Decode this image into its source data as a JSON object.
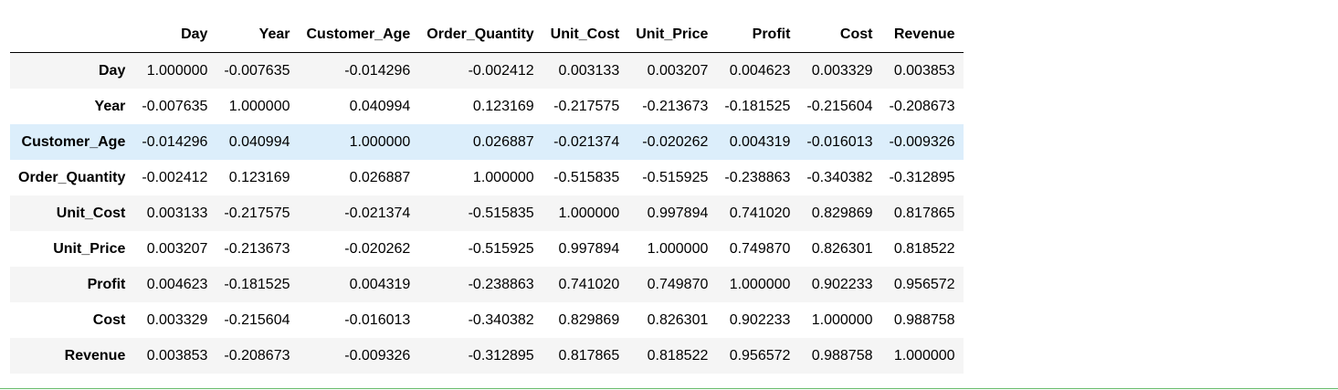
{
  "table": {
    "columns": [
      "",
      "Day",
      "Year",
      "Customer_Age",
      "Order_Quantity",
      "Unit_Cost",
      "Unit_Price",
      "Profit",
      "Cost",
      "Revenue"
    ],
    "rows": [
      {
        "label": "Day",
        "values": [
          "1.000000",
          "-0.007635",
          "-0.014296",
          "-0.002412",
          "0.003133",
          "0.003207",
          "0.004623",
          "0.003329",
          "0.003853"
        ]
      },
      {
        "label": "Year",
        "values": [
          "-0.007635",
          "1.000000",
          "0.040994",
          "0.123169",
          "-0.217575",
          "-0.213673",
          "-0.181525",
          "-0.215604",
          "-0.208673"
        ]
      },
      {
        "label": "Customer_Age",
        "values": [
          "-0.014296",
          "0.040994",
          "1.000000",
          "0.026887",
          "-0.021374",
          "-0.020262",
          "0.004319",
          "-0.016013",
          "-0.009326"
        ]
      },
      {
        "label": "Order_Quantity",
        "values": [
          "-0.002412",
          "0.123169",
          "0.026887",
          "1.000000",
          "-0.515835",
          "-0.515925",
          "-0.238863",
          "-0.340382",
          "-0.312895"
        ]
      },
      {
        "label": "Unit_Cost",
        "values": [
          "0.003133",
          "-0.217575",
          "-0.021374",
          "-0.515835",
          "1.000000",
          "0.997894",
          "0.741020",
          "0.829869",
          "0.817865"
        ]
      },
      {
        "label": "Unit_Price",
        "values": [
          "0.003207",
          "-0.213673",
          "-0.020262",
          "-0.515925",
          "0.997894",
          "1.000000",
          "0.749870",
          "0.826301",
          "0.818522"
        ]
      },
      {
        "label": "Profit",
        "values": [
          "0.004623",
          "-0.181525",
          "0.004319",
          "-0.238863",
          "0.741020",
          "0.749870",
          "1.000000",
          "0.902233",
          "0.956572"
        ]
      },
      {
        "label": "Cost",
        "values": [
          "0.003329",
          "-0.215604",
          "-0.016013",
          "-0.340382",
          "0.829869",
          "0.826301",
          "0.902233",
          "1.000000",
          "0.988758"
        ]
      },
      {
        "label": "Revenue",
        "values": [
          "0.003853",
          "-0.208673",
          "-0.009326",
          "-0.312895",
          "0.817865",
          "0.818522",
          "0.956572",
          "0.988758",
          "1.000000"
        ]
      }
    ],
    "hovered_row": "Customer_Age"
  },
  "colors": {
    "stripe": "#f5f5f5",
    "hover": "#dceefb",
    "cell_border_active": "#66bb6a"
  }
}
